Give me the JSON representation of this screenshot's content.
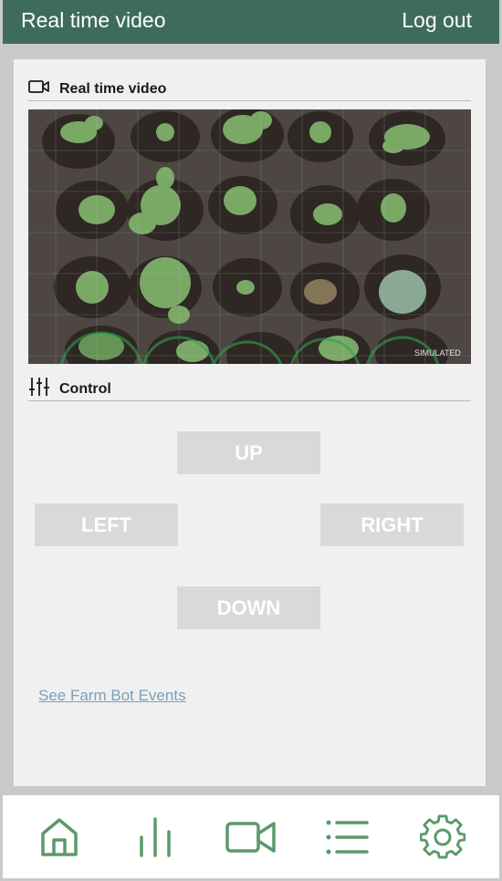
{
  "header": {
    "title": "Real time video",
    "logout_label": "Log out"
  },
  "video_section": {
    "title": "Real time video",
    "icon": "video-camera-icon",
    "overlay_label": "SIMULATED"
  },
  "control_section": {
    "title": "Control",
    "icon": "sliders-icon"
  },
  "controls": {
    "up": "UP",
    "left": "LEFT",
    "right": "RIGHT",
    "down": "DOWN"
  },
  "events_link": "See Farm Bot Events",
  "nav": [
    {
      "name": "home",
      "icon": "home-icon"
    },
    {
      "name": "stats",
      "icon": "bar-chart-icon"
    },
    {
      "name": "video",
      "icon": "video-camera-icon"
    },
    {
      "name": "list",
      "icon": "list-icon"
    },
    {
      "name": "settings",
      "icon": "gear-icon"
    }
  ],
  "colors": {
    "header_bg": "#3f6b5f",
    "accent_green": "#5a9a6a",
    "button_bg": "#d9d9d9",
    "link": "#7d9fb9",
    "panel_bg": "#f0f0f0"
  }
}
